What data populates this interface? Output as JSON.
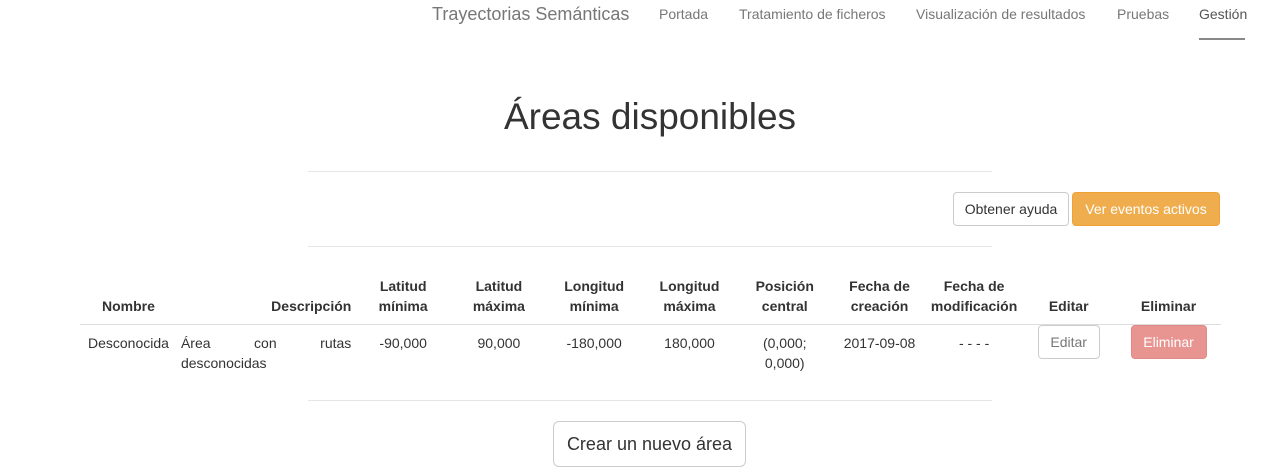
{
  "navbar": {
    "brand": "Trayectorias Semánticas",
    "links": [
      {
        "label": "Portada"
      },
      {
        "label": "Tratamiento de ficheros"
      },
      {
        "label": "Visualización de resultados"
      },
      {
        "label": "Pruebas"
      },
      {
        "label": "Gestión",
        "active": true
      }
    ]
  },
  "main": {
    "title": "Áreas disponibles",
    "help_button": "Obtener ayuda",
    "events_button": "Ver eventos activos",
    "create_button": "Crear un nuevo área"
  },
  "table": {
    "headers": {
      "name": "Nombre",
      "description": "Descripción",
      "lat_min_1": "Latitud",
      "lat_min_2": "mínima",
      "lat_max_1": "Latitud",
      "lat_max_2": "máxima",
      "lon_min_1": "Longitud",
      "lon_min_2": "mínima",
      "lon_max_1": "Longitud",
      "lon_max_2": "máxima",
      "center_1": "Posición",
      "center_2": "central",
      "created_1": "Fecha de",
      "created_2": "creación",
      "modified_1": "Fecha de",
      "modified_2": "modificación",
      "edit": "Editar",
      "delete": "Eliminar"
    },
    "rows": [
      {
        "name": "Desconocida",
        "description": "Área con rutas desconocidas",
        "lat_min": "-90,000",
        "lat_max": "90,000",
        "lon_min": "-180,000",
        "lon_max": "180,000",
        "center_1": "(0,000;",
        "center_2": "0,000)",
        "created": "2017-09-08",
        "modified": "- - - -",
        "edit_label": "Editar",
        "delete_label": "Eliminar"
      }
    ]
  },
  "colors": {
    "warning": "#f0ad4e",
    "danger_light": "#e89491",
    "nav_text": "#777777"
  }
}
